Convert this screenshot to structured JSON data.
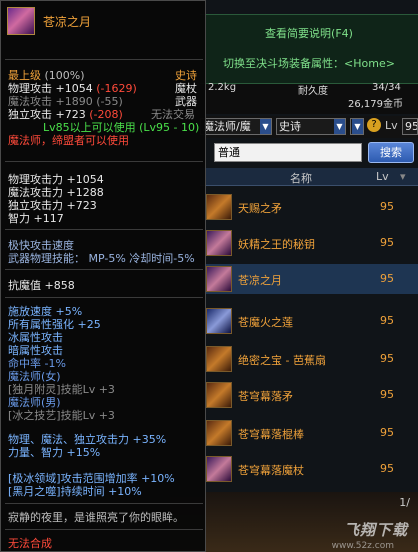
{
  "right_panel": {
    "help_text": "查看简要说明(F4)",
    "switch_text": "切换至决斗场装备属性：<Home>",
    "weight": "2.2kg",
    "durability_label": "耐久度",
    "durability_value": "34/34",
    "price": "26,179金币",
    "filter_class": "魔法师/魔",
    "filter_rarity": "史诗",
    "filter_lv_label": "Lv",
    "filter_lv_value": "95",
    "search_value": "普通",
    "search_button": "搜索",
    "col_name": "名称",
    "col_lv": "Lv",
    "items": [
      {
        "name": "天赐之矛",
        "lv": "95"
      },
      {
        "name": "妖精之王的秘钥",
        "lv": "95"
      },
      {
        "name": "苍凉之月",
        "lv": "95"
      },
      {
        "name": "苍魔火之莲",
        "lv": "95"
      },
      {
        "name": "绝密之宝 - 芭蕉扇",
        "lv": "95"
      },
      {
        "name": "苍穹幕落矛",
        "lv": "95"
      },
      {
        "name": "苍穹幕落棍棒",
        "lv": "95"
      },
      {
        "name": "苍穹幕落魔杖",
        "lv": "95"
      }
    ],
    "page_indicator": "1/",
    "watermark": "飞翔下载",
    "watermark_sub": "www.52z.com"
  },
  "tooltip": {
    "item_name": "苍凉之月",
    "grade": "最上级",
    "grade_pct": "(100%)",
    "rarity": "史诗",
    "weapon_type": "魔杖",
    "category": "武器",
    "phys_atk_label": "物理攻击",
    "phys_atk_val": "+1054",
    "phys_atk_diff": "(-1629)",
    "mag_atk_label": "魔法攻击",
    "mag_atk_val": "+1890",
    "mag_atk_diff": "(-55)",
    "ind_atk_label": "独立攻击",
    "ind_atk_val": "+723",
    "ind_atk_diff": "(-208)",
    "untradeable": "无法交易",
    "level_req": "Lv85以上可以使用 (Lv95 - 10)",
    "class_req": "魔法师，缔盟者可以使用",
    "stats": [
      "物理攻击力 +1054",
      "魔法攻击力 +1288",
      "独立攻击力 +723",
      "智力 +117"
    ],
    "speed_line": "极快攻击速度",
    "skill_mp": "武器物理技能：  MP-5% 冷却时间-5%",
    "resist_label": "抗魔值",
    "resist_val": "+858",
    "bonus_cast_speed": "施放速度 +5%",
    "bonus_all_element": "所有属性强化 +25",
    "bonus_ice": "冰属性攻击",
    "bonus_dark": "暗属性攻击",
    "bonus_hit": "命中率 -1%",
    "bonus_class_f": "魔法师(女)",
    "bonus_skill_f": "[独月附灵]技能Lv +3",
    "bonus_class_m": "魔法师(男)",
    "bonus_skill_m": "[冰之技艺]技能Lv +3",
    "bonus_atk_pct": "物理、魔法、独立攻击力 +35%",
    "bonus_str_int": "力量、智力 +15%",
    "bonus_range": "[极冰领域]攻击范围增加率 +10%",
    "bonus_duration": "[黑月之噬]持续时间 +10%",
    "flavor": "寂静的夜里，是谁照亮了你的眼眸。",
    "no_fusion": "无法合成"
  },
  "colors": {
    "gold": "#f0a23a",
    "red": "#ff4a3a",
    "green": "#4ae04a",
    "blue": "#6a9ae8",
    "header_green": "#7fe08a"
  }
}
